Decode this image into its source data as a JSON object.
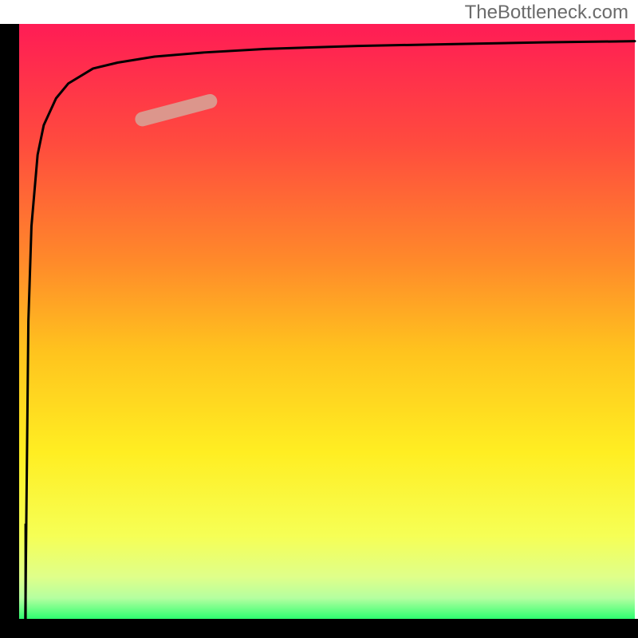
{
  "watermark": "TheBottleneck.com",
  "chart_data": {
    "type": "line",
    "title": "",
    "xlabel": "",
    "ylabel": "",
    "xlim": [
      0,
      100
    ],
    "ylim": [
      0,
      100
    ],
    "curve_x": [
      1,
      1.5,
      2,
      3,
      4,
      6,
      8,
      12,
      16,
      22,
      30,
      40,
      55,
      70,
      85,
      100
    ],
    "curve_y": [
      0,
      50,
      66,
      78,
      83,
      87.5,
      90,
      92.5,
      93.5,
      94.5,
      95.2,
      95.8,
      96.3,
      96.6,
      96.9,
      97.1
    ],
    "notch_x": [
      1.05,
      1.05
    ],
    "notch_y": [
      0,
      16
    ],
    "highlight_band": {
      "x_start": 20,
      "x_end": 31,
      "y_start": 84,
      "y_end": 87
    },
    "gradient_stops": [
      {
        "offset": 0.0,
        "color": "#FF1C55"
      },
      {
        "offset": 0.2,
        "color": "#FF4B3E"
      },
      {
        "offset": 0.4,
        "color": "#FF8A2A"
      },
      {
        "offset": 0.55,
        "color": "#FFC31E"
      },
      {
        "offset": 0.72,
        "color": "#FFEE22"
      },
      {
        "offset": 0.86,
        "color": "#F6FF55"
      },
      {
        "offset": 0.93,
        "color": "#DFFF8A"
      },
      {
        "offset": 0.965,
        "color": "#B5FFA0"
      },
      {
        "offset": 1.0,
        "color": "#2EFF70"
      }
    ],
    "axis_color": "#000000",
    "axis_thickness_px": 24
  }
}
